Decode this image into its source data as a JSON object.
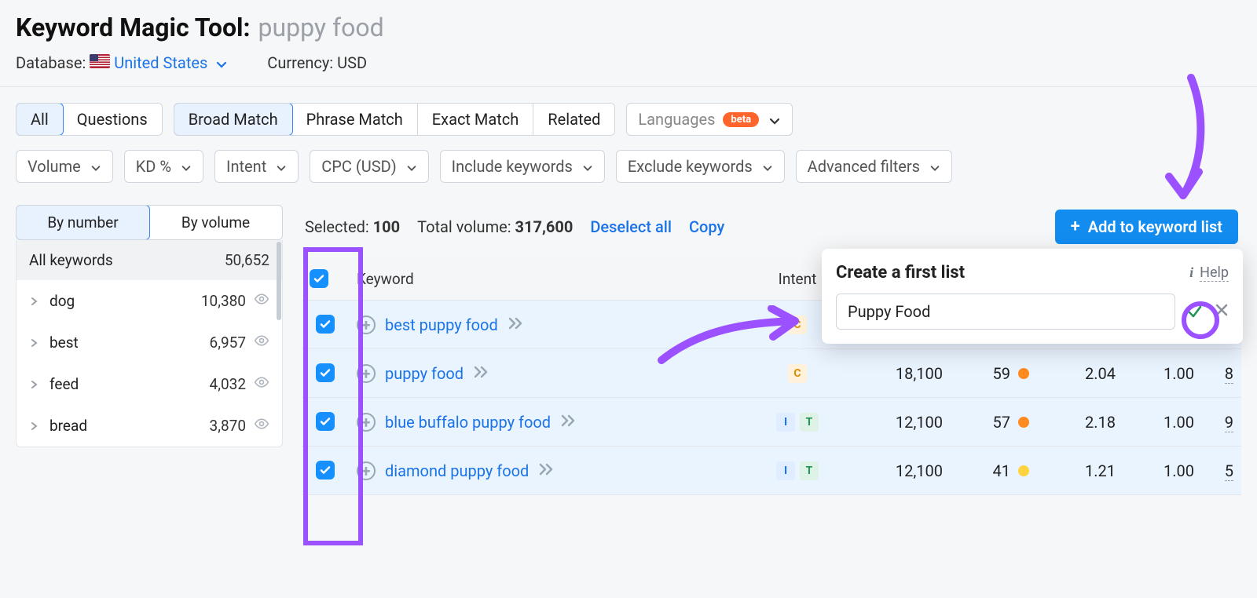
{
  "header": {
    "tool_name": "Keyword Magic Tool:",
    "query": "puppy food",
    "database_label": "Database:",
    "database_value": "United States",
    "currency_label": "Currency: USD"
  },
  "type_tabs": {
    "all": "All",
    "questions": "Questions"
  },
  "match_tabs": {
    "broad": "Broad Match",
    "phrase": "Phrase Match",
    "exact": "Exact Match",
    "related": "Related"
  },
  "languages": {
    "label": "Languages",
    "badge": "beta"
  },
  "filters": {
    "volume": "Volume",
    "kd": "KD %",
    "intent": "Intent",
    "cpc": "CPC (USD)",
    "include": "Include keywords",
    "exclude": "Exclude keywords",
    "advanced": "Advanced filters"
  },
  "sidebar": {
    "tab_number": "By number",
    "tab_volume": "By volume",
    "all_label": "All keywords",
    "all_count": "50,652",
    "groups": [
      {
        "name": "dog",
        "count": "10,380"
      },
      {
        "name": "best",
        "count": "6,957"
      },
      {
        "name": "feed",
        "count": "4,032"
      },
      {
        "name": "bread",
        "count": "3,870"
      }
    ]
  },
  "toolbar": {
    "selected_label": "Selected:",
    "selected_value": "100",
    "total_volume_label": "Total volume:",
    "total_volume_value": "317,600",
    "deselect": "Deselect all",
    "copy": "Copy",
    "add_button": "Add to keyword list"
  },
  "columns": {
    "keyword": "Keyword",
    "intent": "Intent"
  },
  "rows": [
    {
      "keyword": "best puppy food",
      "intents": [
        "C"
      ],
      "volume": "",
      "kd": "",
      "kd_color": "",
      "cpc": "",
      "comp": "",
      "res": ""
    },
    {
      "keyword": "puppy food",
      "intents": [
        "C"
      ],
      "volume": "18,100",
      "kd": "59",
      "kd_color": "orange",
      "cpc": "2.04",
      "comp": "1.00",
      "res": "8"
    },
    {
      "keyword": "blue buffalo puppy food",
      "intents": [
        "I",
        "T"
      ],
      "volume": "12,100",
      "kd": "57",
      "kd_color": "orange",
      "cpc": "2.18",
      "comp": "1.00",
      "res": "9"
    },
    {
      "keyword": "diamond puppy food",
      "intents": [
        "I",
        "T"
      ],
      "volume": "12,100",
      "kd": "41",
      "kd_color": "yellow",
      "cpc": "1.21",
      "comp": "1.00",
      "res": "5"
    }
  ],
  "popover": {
    "title": "Create a first list",
    "help": "Help",
    "input_value": "Puppy Food"
  }
}
